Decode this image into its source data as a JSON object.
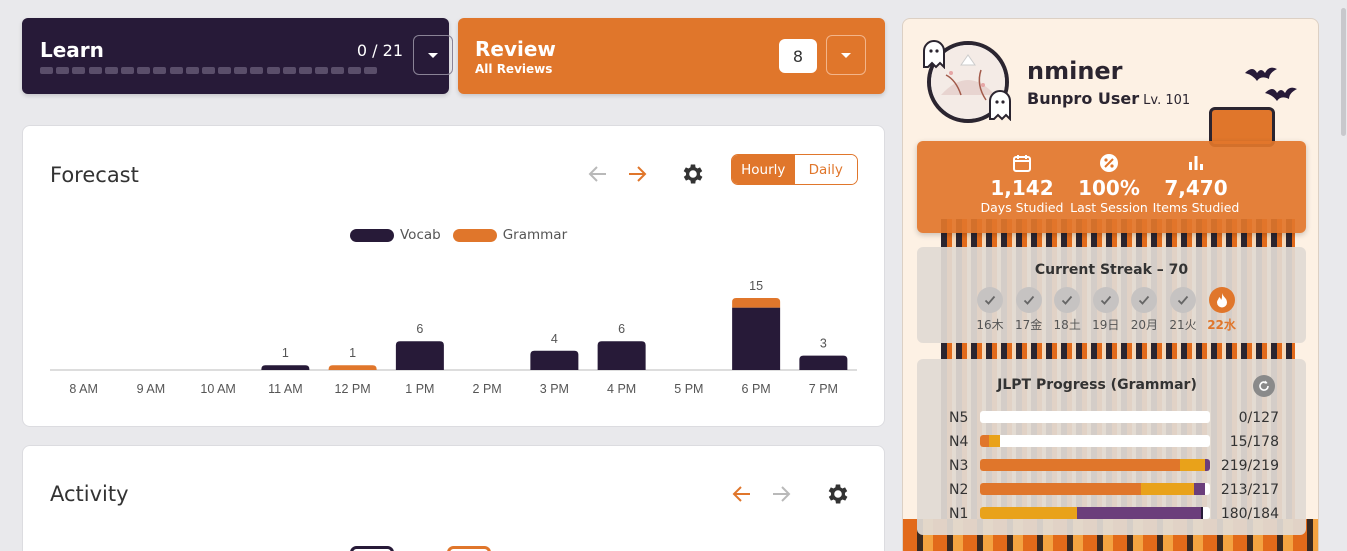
{
  "learn": {
    "title": "Learn",
    "count": "0 / 21",
    "dot_count": 21
  },
  "review": {
    "title": "Review",
    "subtitle": "All Reviews",
    "count": "8"
  },
  "forecast": {
    "title": "Forecast",
    "toggle": {
      "hourly": "Hourly",
      "daily": "Daily"
    },
    "legend": {
      "vocab": "Vocab",
      "grammar": "Grammar"
    }
  },
  "activity": {
    "title": "Activity"
  },
  "colors": {
    "vocab": "#271a38",
    "grammar": "#e0762b",
    "accent": "#e0762b",
    "gold": "#e9a21a",
    "purple": "#6b3e7b"
  },
  "chart_data": {
    "type": "bar",
    "stacked": true,
    "categories": [
      "8 AM",
      "9 AM",
      "10 AM",
      "11 AM",
      "12 PM",
      "1 PM",
      "2 PM",
      "3 PM",
      "4 PM",
      "5 PM",
      "6 PM",
      "7 PM"
    ],
    "series": [
      {
        "name": "Vocab",
        "values": [
          0,
          0,
          0,
          1,
          0,
          6,
          0,
          4,
          6,
          0,
          13,
          3
        ]
      },
      {
        "name": "Grammar",
        "values": [
          0,
          0,
          0,
          0,
          1,
          0,
          0,
          0,
          0,
          0,
          2,
          0
        ]
      }
    ],
    "labels": [
      "",
      "",
      "",
      "1",
      "1",
      "6",
      "",
      "4",
      "6",
      "",
      "15",
      "3"
    ],
    "ylim": [
      0,
      15
    ],
    "grid": false,
    "legend": "top-center"
  },
  "profile": {
    "username": "nminer",
    "rank": "Bunpro User",
    "level": "Lv. 101",
    "stats": [
      {
        "value": "1,142",
        "label": "Days Studied",
        "icon": "calendar-icon"
      },
      {
        "value": "100%",
        "label": "Last Session",
        "icon": "percent-icon"
      },
      {
        "value": "7,470",
        "label": "Items Studied",
        "icon": "bar-chart-icon"
      }
    ],
    "streak": {
      "title": "Current Streak – 70",
      "days": [
        {
          "label": "16木",
          "today": false
        },
        {
          "label": "17金",
          "today": false
        },
        {
          "label": "18土",
          "today": false
        },
        {
          "label": "19日",
          "today": false
        },
        {
          "label": "20月",
          "today": false
        },
        {
          "label": "21火",
          "today": false
        },
        {
          "label": "22水",
          "today": true
        }
      ]
    },
    "jlpt": {
      "title": "JLPT Progress (Grammar)",
      "levels": [
        {
          "level": "N5",
          "value": "0/127",
          "segments": []
        },
        {
          "level": "N4",
          "value": "15/178",
          "segments": [
            {
              "fraction": 0.04,
              "color": "#e0762b"
            },
            {
              "fraction": 0.045,
              "color": "#e9a21a"
            }
          ]
        },
        {
          "level": "N3",
          "value": "219/219",
          "segments": [
            {
              "fraction": 0.87,
              "color": "#e0762b"
            },
            {
              "fraction": 0.11,
              "color": "#e9a21a"
            },
            {
              "fraction": 0.02,
              "color": "#6b3e7b"
            }
          ]
        },
        {
          "level": "N2",
          "value": "213/217",
          "segments": [
            {
              "fraction": 0.7,
              "color": "#e0762b"
            },
            {
              "fraction": 0.23,
              "color": "#e9a21a"
            },
            {
              "fraction": 0.05,
              "color": "#6b3e7b"
            }
          ]
        },
        {
          "level": "N1",
          "value": "180/184",
          "segments": [
            {
              "fraction": 0.42,
              "color": "#e9a21a"
            },
            {
              "fraction": 0.54,
              "color": "#6b3e7b"
            },
            {
              "fraction": 0.01,
              "color": "#271a38"
            }
          ]
        }
      ]
    }
  }
}
